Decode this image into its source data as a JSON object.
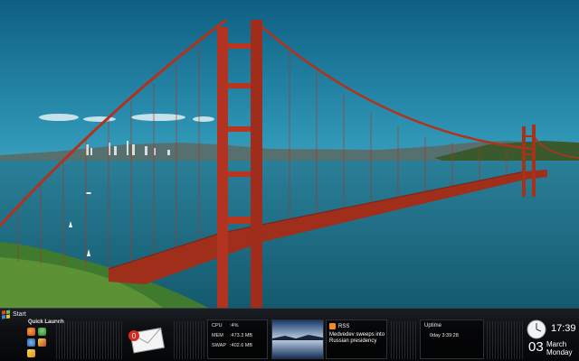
{
  "taskbar": {
    "start_label": "Start",
    "quick_launch_title": "Quick Launch",
    "quick_launch_icons": [
      "firefox-icon",
      "users-icon",
      "network-icon",
      "paint-icon",
      "bolt-icon"
    ]
  },
  "mail": {
    "unread_count": "0"
  },
  "system_monitor": {
    "cpu_label": "CPU",
    "cpu_value": ":4%",
    "mem_label": "MEM",
    "mem_value": ":473.3 MB",
    "swap_label": "SWAP",
    "swap_value": ":402.6 MB"
  },
  "rss": {
    "title": "RSS",
    "headline": "Medvedev sweeps into Russian presidency"
  },
  "uptime": {
    "title": "Uptime",
    "value": "0day 3:39:28"
  },
  "clock": {
    "time": "17:39",
    "day": "03",
    "month": "March",
    "weekday": "Monday"
  },
  "colors": {
    "bridge": "#c0391e",
    "sky_top": "#0f6b8c",
    "sea": "#1e6e86",
    "taskbar": "#0d0f12"
  }
}
